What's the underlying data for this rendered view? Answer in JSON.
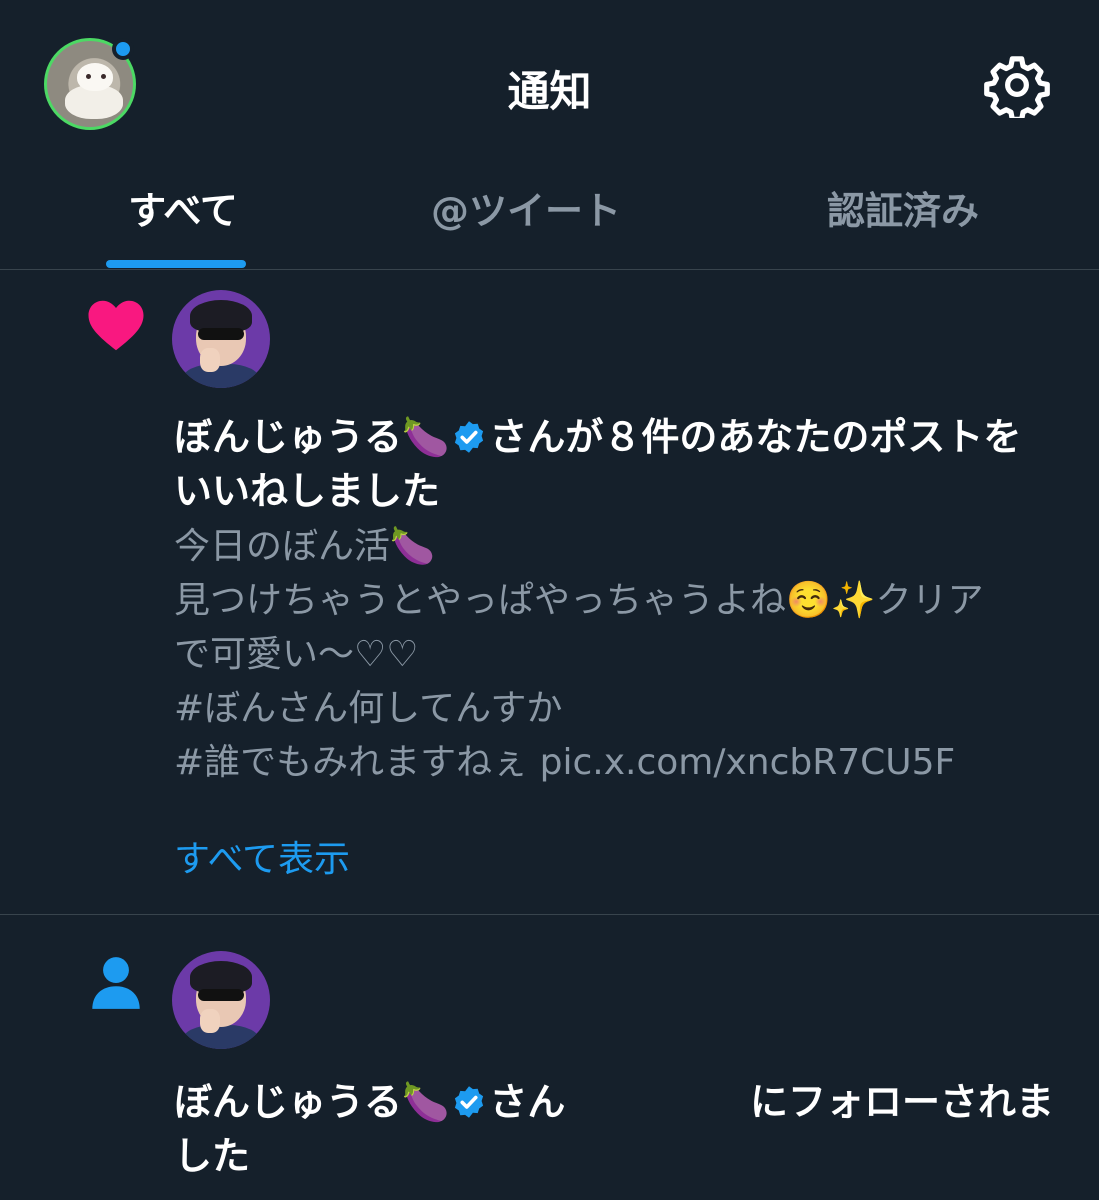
{
  "header": {
    "title": "通知",
    "settings_icon": "gear-icon",
    "avatar": "ferret-avatar",
    "accent_color": "#1d9bf0"
  },
  "tabs": [
    {
      "label": "すべて",
      "active": true
    },
    {
      "label": "@ツイート",
      "active": false
    },
    {
      "label": "認証済み",
      "active": false
    }
  ],
  "notifications": [
    {
      "type_icon": "heart-icon",
      "user_name": "ぼんじゅうる🍆",
      "action_text": "さんが８件のあなたのポストを",
      "action_text_cont": "いいねしました",
      "post_lines": [
        "今日のぼん活🍆",
        "見つけちゃうとやっぱやっちゃうよね☺️✨クリア",
        "で可愛い〜♡♡",
        "#ぼんさん何してんすか",
        "#誰でもみれますねぇ pic.x.com/xncbR7CU5F"
      ],
      "show_all_label": "すべて表示",
      "heart_color": "#f91880"
    },
    {
      "type_icon": "person-icon",
      "user_name": "ぼんじゅうる🍆",
      "action_text": "さん",
      "action_text_right": "にフォローされま",
      "action_text_cont": "した"
    }
  ]
}
